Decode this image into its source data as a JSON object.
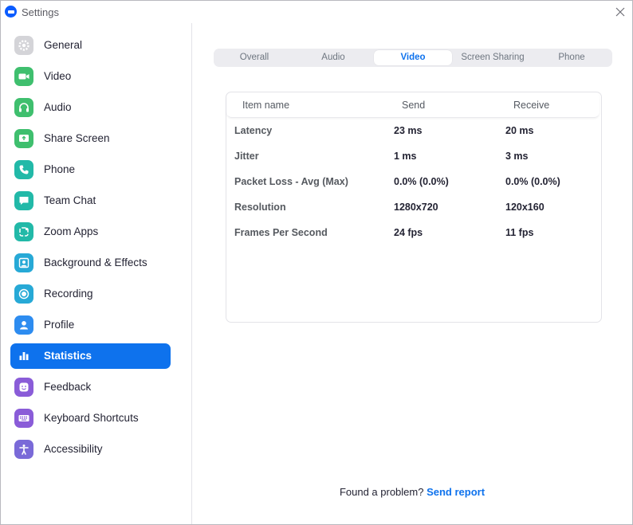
{
  "window": {
    "title": "Settings"
  },
  "colors": {
    "accent": "#0e72ed",
    "active_item_bg": "#0e72ed"
  },
  "sidebar": {
    "items": [
      {
        "label": "General",
        "icon": "gear-icon",
        "color": "#d4d4d8",
        "active": false
      },
      {
        "label": "Video",
        "icon": "video-camera-icon",
        "color": "#3fbf6e",
        "active": false
      },
      {
        "label": "Audio",
        "icon": "headphones-icon",
        "color": "#3fbf6e",
        "active": false
      },
      {
        "label": "Share Screen",
        "icon": "share-screen-icon",
        "color": "#3fbf6e",
        "active": false
      },
      {
        "label": "Phone",
        "icon": "phone-icon",
        "color": "#22b9a8",
        "active": false
      },
      {
        "label": "Team Chat",
        "icon": "chat-icon",
        "color": "#22b9a8",
        "active": false
      },
      {
        "label": "Zoom Apps",
        "icon": "apps-icon",
        "color": "#22b9a8",
        "active": false
      },
      {
        "label": "Background & Effects",
        "icon": "person-background-icon",
        "color": "#27a9d6",
        "active": false
      },
      {
        "label": "Recording",
        "icon": "record-icon",
        "color": "#27a9d6",
        "active": false
      },
      {
        "label": "Profile",
        "icon": "profile-icon",
        "color": "#2d8cf0",
        "active": false
      },
      {
        "label": "Statistics",
        "icon": "bar-chart-icon",
        "color": "#ffffff",
        "active": true
      },
      {
        "label": "Feedback",
        "icon": "smiley-icon",
        "color": "#8a5cd8",
        "active": false
      },
      {
        "label": "Keyboard Shortcuts",
        "icon": "keyboard-icon",
        "color": "#8a5cd8",
        "active": false
      },
      {
        "label": "Accessibility",
        "icon": "accessibility-icon",
        "color": "#7a6ad8",
        "active": false
      }
    ]
  },
  "main": {
    "tabs": [
      {
        "label": "Overall",
        "active": false
      },
      {
        "label": "Audio",
        "active": false
      },
      {
        "label": "Video",
        "active": true
      },
      {
        "label": "Screen Sharing",
        "active": false
      },
      {
        "label": "Phone",
        "active": false
      }
    ],
    "table": {
      "headers": {
        "name": "Item name",
        "send": "Send",
        "receive": "Receive"
      },
      "rows": [
        {
          "name": "Latency",
          "send": "23 ms",
          "receive": "20 ms"
        },
        {
          "name": "Jitter",
          "send": "1 ms",
          "receive": "3 ms"
        },
        {
          "name": "Packet Loss - Avg (Max)",
          "send": "0.0% (0.0%)",
          "receive": "0.0% (0.0%)"
        },
        {
          "name": "Resolution",
          "send": "1280x720",
          "receive": "120x160"
        },
        {
          "name": "Frames Per Second",
          "send": "24 fps",
          "receive": "11 fps"
        }
      ]
    },
    "footer": {
      "prompt": "Found a problem? ",
      "link": "Send report"
    }
  }
}
